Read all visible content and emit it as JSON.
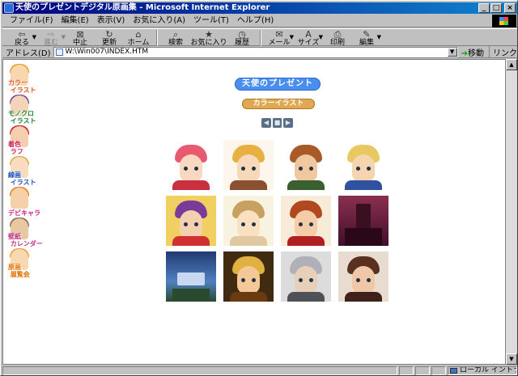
{
  "window": {
    "title": "天使のプレゼントデジタル原画集 - Microsoft Internet Explorer",
    "minimize": "_",
    "maximize": "□",
    "close": "×"
  },
  "menu": [
    "ファイル(F)",
    "編集(E)",
    "表示(V)",
    "お気に入り(A)",
    "ツール(T)",
    "ヘルプ(H)"
  ],
  "toolbar": {
    "back": "戻る",
    "forward": "進む",
    "stop": "中止",
    "refresh": "更新",
    "home": "ホーム",
    "search": "検索",
    "favorites": "お気に入り",
    "history": "履歴",
    "mail": "メール",
    "size": "サイズ",
    "print": "印刷",
    "edit": "編集"
  },
  "addressbar": {
    "label": "アドレス(D)",
    "url": "W:\\Win007\\INDEX.HTM",
    "go": "移動",
    "links": "リンク"
  },
  "status": {
    "zone": "ローカル イントラネット"
  },
  "sidenav": [
    {
      "label": "カラー\n イラスト",
      "hair": "#e8a030",
      "skin": "#f7d6b0",
      "color": "#e05010"
    },
    {
      "label": "モノクロ\n イラスト",
      "hair": "#7a4c9a",
      "skin": "#f3d4b8",
      "color": "#208030"
    },
    {
      "label": "着色\n ラフ",
      "hair": "#c03030",
      "skin": "#f5cdb0",
      "color": "#d02050"
    },
    {
      "label": "線画\n イラスト",
      "hair": "#d8b050",
      "skin": "#f7dcc0",
      "color": "#2050c0"
    },
    {
      "label": "デビキャラ",
      "hair": "#e88020",
      "skin": "#f5d0a8",
      "color": "#d02080"
    },
    {
      "label": "壁紙\n カレンダー",
      "hair": "#8a6a50",
      "skin": "#e8c8a0",
      "color": "#c03080"
    },
    {
      "label": "原画\n 展覧会",
      "hair": "#f0a040",
      "skin": "#f8d8b0",
      "color": "#e07000"
    }
  ],
  "main": {
    "heading": "天使のプレゼント",
    "subheading": "カラーイラスト"
  },
  "pager": {
    "prev": "◀",
    "home": "■",
    "next": "▶"
  },
  "gallery": [
    {
      "name": "pink-haired-girl",
      "bg": "#ffffff",
      "hair": "#e85a70",
      "skin": "#f8d8c0",
      "body": "#c83040"
    },
    {
      "name": "blonde-girl",
      "bg": "#fdf6ec",
      "hair": "#e8b040",
      "skin": "#f7d8b8",
      "body": "#8a5030"
    },
    {
      "name": "auburn-boy",
      "bg": "#ffffff",
      "hair": "#a85a28",
      "skin": "#f0c8a0",
      "body": "#3a6030"
    },
    {
      "name": "blond-boy",
      "bg": "#ffffff",
      "hair": "#e8c860",
      "skin": "#f5d4b0",
      "body": "#3050a0"
    },
    {
      "name": "witch-girl",
      "bg": "#f0d060",
      "hair": "#7a3a9a",
      "skin": "#f5d0b0",
      "body": "#d03030"
    },
    {
      "name": "sketch-girl",
      "bg": "#f8f2e0",
      "hair": "#c8a060",
      "skin": "#f8e0c0",
      "body": "#e0c8a0"
    },
    {
      "name": "goggles-girl",
      "bg": "#f8ecd8",
      "hair": "#b04820",
      "skin": "#f5cca8",
      "body": "#b02020"
    },
    {
      "name": "castle-scene",
      "bg": "#6a2040",
      "hair": "#3a1020",
      "skin": "#8a3050",
      "body": "#40102a"
    },
    {
      "name": "night-castle",
      "bg": "#203a70",
      "hair": "#5080c0",
      "skin": "#c8d8f0",
      "body": "#2a4a30"
    },
    {
      "name": "smiling-girl",
      "bg": "#402a10",
      "hair": "#e0b040",
      "skin": "#f5c898",
      "body": "#6a3a10"
    },
    {
      "name": "silver-haired-boy",
      "bg": "#dcdcdc",
      "hair": "#b0b0b8",
      "skin": "#e8d0b8",
      "body": "#505058"
    },
    {
      "name": "dark-haired-man",
      "bg": "#e8dcd0",
      "hair": "#5a3020",
      "skin": "#f0c8a8",
      "body": "#402018"
    }
  ]
}
